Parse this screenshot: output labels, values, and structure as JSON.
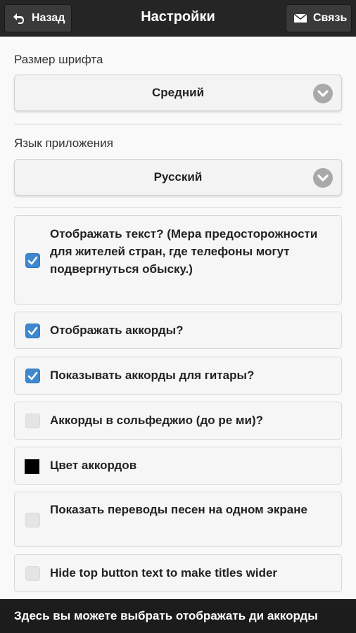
{
  "header": {
    "title": "Настройки",
    "back_label": "Назад",
    "back_icon": "undo-arrow-icon",
    "contact_label": "Связь",
    "contact_icon": "envelope-icon"
  },
  "font_size": {
    "label": "Размер шрифта",
    "value": "Средний"
  },
  "language": {
    "label": "Язык приложения",
    "value": "Русский"
  },
  "options": [
    {
      "label": "Отображать текст? (Мера предосторожности для жителей стран, где телефоны могут подвергнуться обыску.)",
      "checked": true
    },
    {
      "label": "Отображать аккорды?",
      "checked": true
    },
    {
      "label": "Показывать аккорды для гитары?",
      "checked": true
    },
    {
      "label": "Аккорды в сольфеджио (до ре ми)?",
      "checked": false
    },
    {
      "label": "Цвет аккордов",
      "color": "#000000"
    },
    {
      "label": "Показать переводы песен на одном экране",
      "checked": false
    },
    {
      "label": "Hide top button text to make titles wider",
      "checked": false
    }
  ],
  "toast": {
    "text": "Здесь вы можете выбрать отображать ди аккорды"
  },
  "colors": {
    "accent": "#3d88ce",
    "topbar": "#252525",
    "background": "#f9f9f9"
  }
}
